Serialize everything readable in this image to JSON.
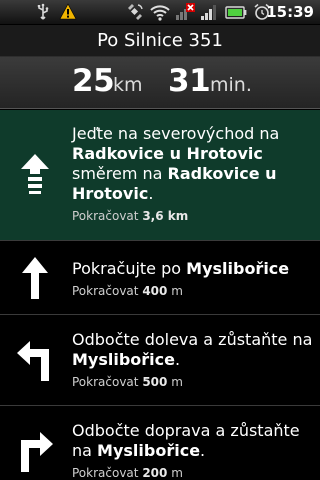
{
  "status_bar": {
    "time": "15:39",
    "icons": [
      "usb-icon",
      "warning-icon",
      "gps-icon",
      "wifi-icon",
      "signal-off-icon",
      "signal-icon",
      "battery-icon",
      "alarm-icon"
    ]
  },
  "route": {
    "title": "Po Silnice 351",
    "distance_value": "25",
    "distance_unit": "km",
    "time_value": "31",
    "time_unit": "min."
  },
  "steps": [
    {
      "icon": "straight-arrow-icon",
      "line1": "Jeďte na severovýchod na",
      "bold1": "Radkovice u Hrotovic",
      "line2": "směrem na",
      "bold2": "Radkovice u Hrotovic",
      "end": ".",
      "continue_label": "Pokračovat",
      "continue_value": "3,6 km"
    },
    {
      "icon": "up-arrow-icon",
      "prefix": "Pokračujte po",
      "street": "Myslibořice",
      "continue_label": "Pokračovat",
      "continue_value": "400",
      "continue_unit": "m"
    },
    {
      "icon": "turn-left-icon",
      "prefix": "Odbočte doleva a zůstaňte na",
      "street": "Myslibořice",
      "end": ".",
      "continue_label": "Pokračovat",
      "continue_value": "500",
      "continue_unit": "m"
    },
    {
      "icon": "turn-right-icon",
      "prefix": "Odbočte doprava a zůstaňte na",
      "street": "Myslibořice",
      "end": ".",
      "continue_label": "Pokračovat",
      "continue_value": "200",
      "continue_unit": "m"
    }
  ],
  "colors": {
    "active_step_background": "#0f3b2b",
    "warning": "#f0b400",
    "battery": "#4fcf3f"
  }
}
